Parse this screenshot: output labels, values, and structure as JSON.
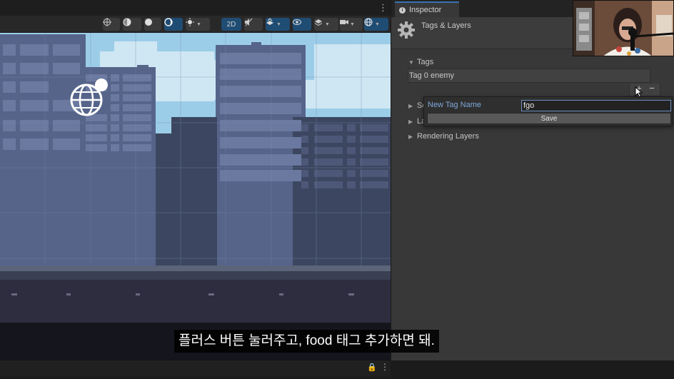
{
  "window": {
    "menu_dots": "⋮"
  },
  "scene_view": {
    "toolbar": {
      "buttons": [
        {
          "name": "pivot-toggle",
          "icon": "crosshair-icon"
        },
        {
          "name": "shading-mode",
          "icon": "sphere-icon"
        },
        {
          "name": "shaded",
          "icon": "circle-icon"
        },
        {
          "name": "wireframe",
          "icon": "moon-icon",
          "active": true
        },
        {
          "name": "lighting",
          "icon": "sun-icon"
        },
        {
          "name": "2d-toggle",
          "label": "2D",
          "active": true
        },
        {
          "name": "audio-toggle",
          "icon": "mute-icon"
        },
        {
          "name": "effects",
          "icon": "effects-icon",
          "active": true
        },
        {
          "name": "visibility",
          "icon": "eye-icon",
          "active": true
        },
        {
          "name": "layers",
          "icon": "layers-icon"
        },
        {
          "name": "camera",
          "icon": "camera-icon"
        },
        {
          "name": "gizmos",
          "icon": "globe-icon",
          "active": true
        }
      ],
      "twod_label": "2D"
    },
    "footer": {
      "lock_icon": "lock-icon",
      "menu_dots": "⋮"
    },
    "colors": {
      "sky": "#9ccde8",
      "building": "#46516e",
      "ground": "#2a2a3a"
    }
  },
  "inspector": {
    "tab_label": "Inspector",
    "title": "Tags & Layers",
    "tags_label": "Tags",
    "tag_items": [
      "Tag 0 enemy"
    ],
    "plus": "+",
    "minus": "−",
    "foldouts": {
      "sorting_layers": "So",
      "layers": "La",
      "rendering_layers": "Rendering Layers"
    },
    "popup": {
      "label": "New Tag Name",
      "value": "fgo",
      "save_label": "Save"
    }
  },
  "subtitle": "플러스 버튼 눌러주고, food 태그 추가하면 돼."
}
